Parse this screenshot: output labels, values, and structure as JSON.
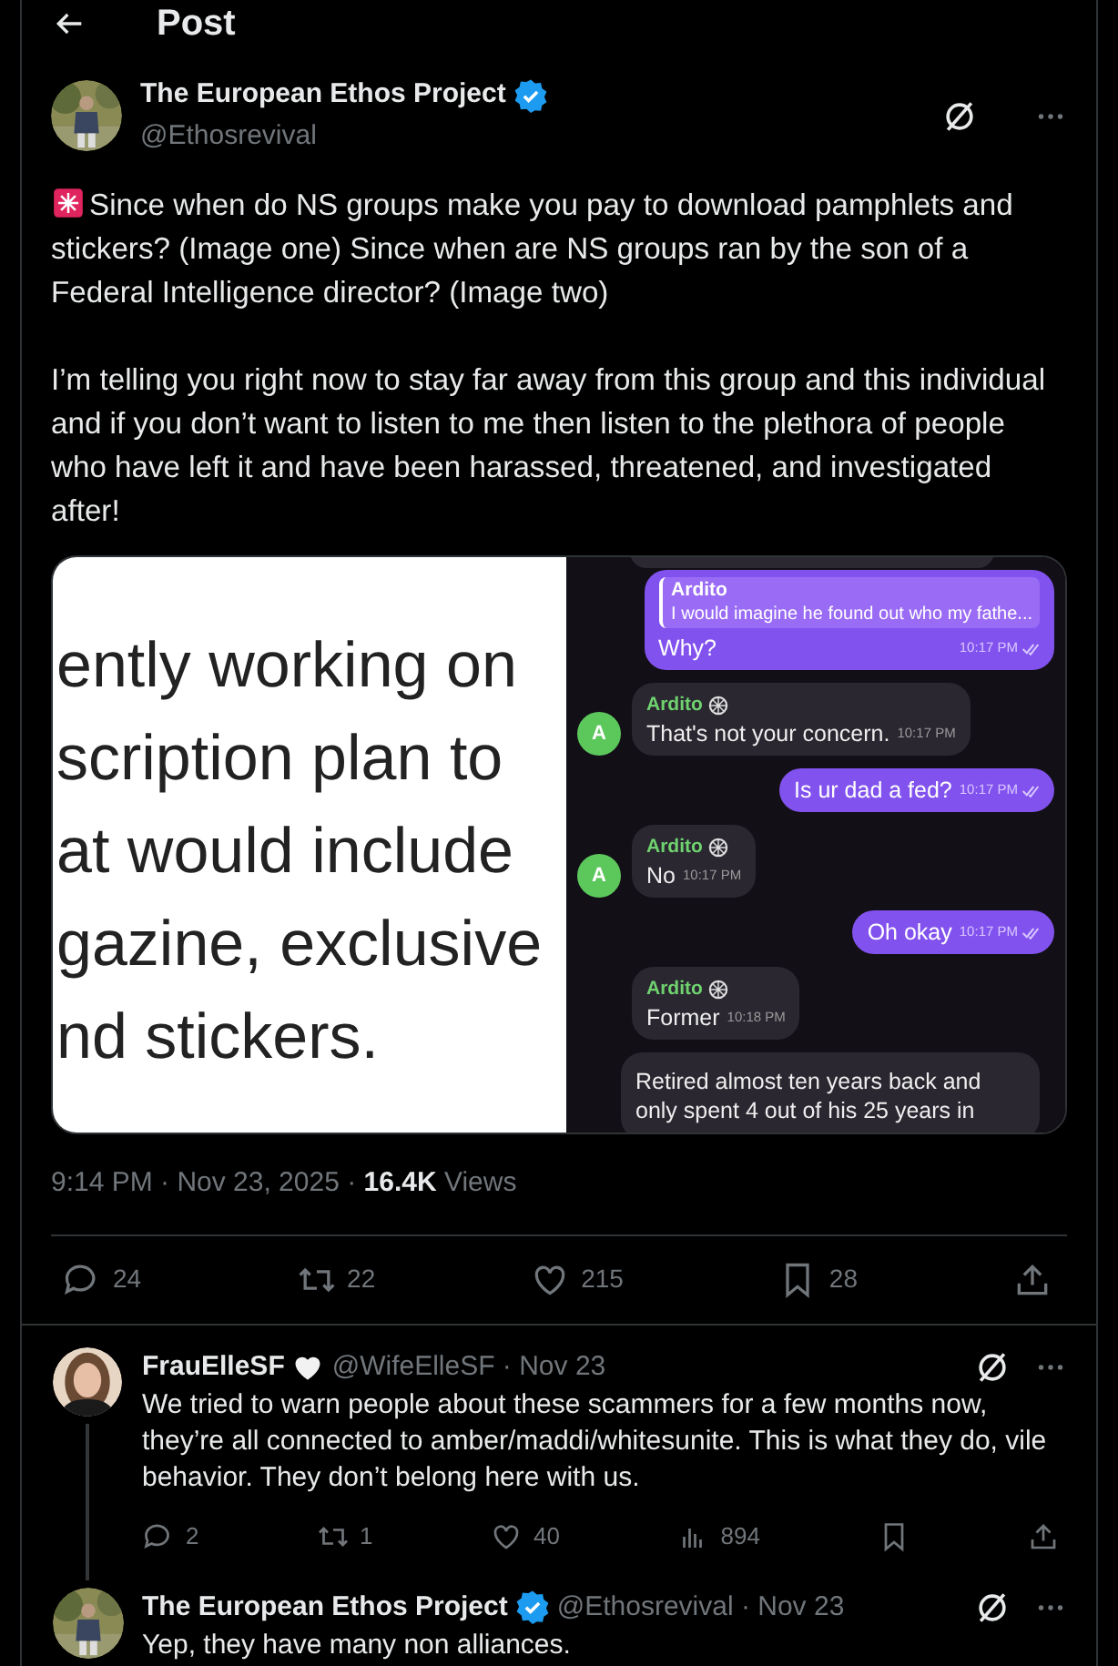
{
  "header": {
    "title": "Post"
  },
  "post": {
    "author": "The European Ethos Project",
    "verified": true,
    "handle": "@Ethosrevival",
    "paragraphs": [
      "Since when do NS groups make you pay to download pamphlets and stickers? (Image one) Since when are NS groups ran by the son of a Federal Intelligence director? (Image two)",
      "I’m telling you right now to stay far away from this group and this individual and if you don’t want to listen to me then listen to the plethora of people who have left it and have been harassed, threatened, and investigated after!"
    ],
    "image_one": {
      "lines": [
        "ently working on",
        "scription plan to",
        "at would include",
        "gazine, exclusive",
        "nd stickers."
      ]
    },
    "image_two": {
      "messages": [
        {
          "kind": "out",
          "quote_name": "Ardito",
          "quote": "I would imagine he found out who my fathe...",
          "text": "Why?",
          "time": "10:17 PM",
          "read": true
        },
        {
          "kind": "in",
          "sender": "Ardito",
          "avatar": "A",
          "text": "That's not your concern.",
          "time": "10:17 PM"
        },
        {
          "kind": "out",
          "text": "Is ur dad a fed?",
          "time": "10:17 PM",
          "read": true
        },
        {
          "kind": "in",
          "sender": "Ardito",
          "avatar": "A",
          "text": "No",
          "time": "10:17 PM"
        },
        {
          "kind": "out",
          "text": "Oh okay",
          "time": "10:17 PM",
          "read": true
        },
        {
          "kind": "in",
          "sender": "Ardito",
          "text": "Former",
          "time": "10:18 PM"
        },
        {
          "kind": "in_plain",
          "text": "Retired almost ten years back and only spent 4 out of his 25 years in"
        }
      ]
    },
    "time": "9:14 PM · Nov 23, 2025 · ",
    "views_count": "16.4K",
    "views_label": "Views",
    "actions": [
      {
        "kind": "reply",
        "count": "24"
      },
      {
        "kind": "repost",
        "count": "22"
      },
      {
        "kind": "like",
        "count": "215"
      },
      {
        "kind": "bookmark",
        "count": "28"
      },
      {
        "kind": "share"
      }
    ]
  },
  "replies": [
    {
      "author": "FrauElleSF",
      "heart_badge": true,
      "verified": false,
      "meta": "@WifeElleSF · Nov 23",
      "text": "We tried to warn people about these scammers for a few months now, they’re all connected to amber/maddi/whitesunite. This is what they do, vile behavior. They don’t belong here with us.",
      "thread_line": true,
      "actions": [
        {
          "kind": "reply",
          "count": "2"
        },
        {
          "kind": "repost",
          "count": "1"
        },
        {
          "kind": "like",
          "count": "40"
        },
        {
          "kind": "views",
          "count": "894"
        },
        {
          "kind": "bookmark"
        },
        {
          "kind": "share"
        }
      ]
    },
    {
      "author": "The European Ethos Project",
      "verified": true,
      "meta": "@Ethosrevival · Nov 23",
      "text": "Yep, they have many non alliances.",
      "thread_line": false
    }
  ]
}
